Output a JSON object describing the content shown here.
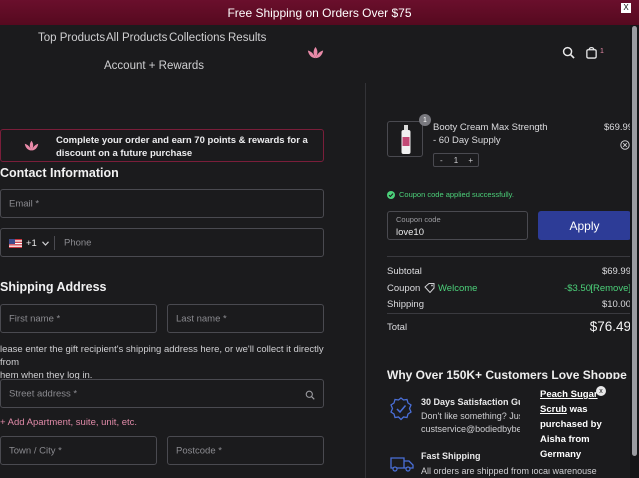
{
  "banner": {
    "text": "Free Shipping on Orders Over $75",
    "close": "X"
  },
  "nav": {
    "items": [
      "Top Products",
      "All Products",
      "Collections",
      "Results",
      "Account + Rewards"
    ],
    "cart_count": "1"
  },
  "rewards": {
    "text": "Complete your order and earn 70 points & rewards for a discount on a future purchase"
  },
  "contact": {
    "title": "Contact Information",
    "email_placeholder": "Email *",
    "country_code": "+1",
    "phone_placeholder": "Phone"
  },
  "shipping": {
    "title": "Shipping Address",
    "first_name_placeholder": "First name *",
    "last_name_placeholder": "Last name *",
    "note_line1": "lease enter the gift recipient's shipping address here, or we'll collect it directly from",
    "note_line2": "hem when they log in.",
    "street_placeholder": "Street address *",
    "add_apartment": "+ Add Apartment, suite, unit, etc.",
    "town_placeholder": "Town / City *",
    "postcode_placeholder": "Postcode *"
  },
  "cart": {
    "product_name": "Booty Cream Max Strength",
    "product_variant": "- 60 Day Supply",
    "price": "$69.99",
    "quantity": "1",
    "qty_badge": "1",
    "minus": "-",
    "plus": "+"
  },
  "coupon": {
    "success": "Coupon code applied successfully.",
    "label": "Coupon code",
    "value": "love10",
    "apply": "Apply"
  },
  "summary": {
    "subtotal_label": "Subtotal",
    "subtotal": "$69.99",
    "coupon_label": "Coupon",
    "coupon_name": "Welcome",
    "coupon_discount": "-$3.50",
    "remove": "[Remove]",
    "shipping_label": "Shipping",
    "shipping": "$10.00",
    "total_label": "Total",
    "total": "$76.49"
  },
  "why": {
    "title": "Why Over 150K+ Customers Love Shoppe",
    "feature1_title": "30 Days Satisfaction Gua",
    "feature1_line1": "Don't like something? Just",
    "feature1_line2": "custservice@bodiedbybella",
    "feature2_title": "Fast Shipping",
    "feature2_line1": "All orders are shipped from local warehouse"
  },
  "popup": {
    "product": "Peach Sugar Scrub",
    "line1": " was purchased by",
    "line2": "Aisha from Germany",
    "close": "x"
  },
  "colors": {
    "banner": "#6a0f2c",
    "accent": "#e98aa8",
    "apply": "#2d3c97",
    "success": "#4cd17a"
  }
}
